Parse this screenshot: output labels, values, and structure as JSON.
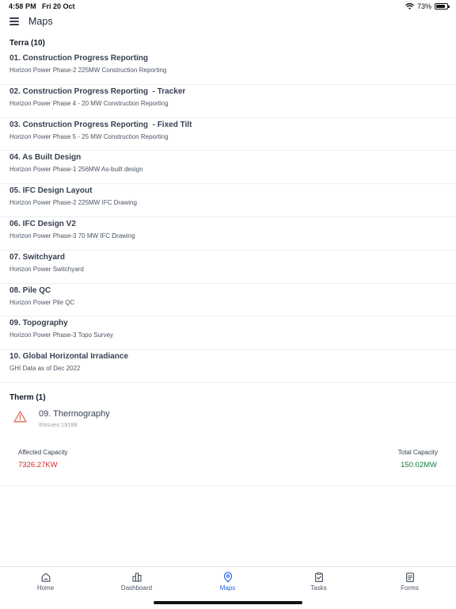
{
  "status_bar": {
    "time": "4:58 PM",
    "date": "Fri 20 Oct",
    "battery": "73%"
  },
  "header": {
    "title": "Maps"
  },
  "terra": {
    "heading": "Terra (10)",
    "items": [
      {
        "name": "01. Construction Progress Reporting",
        "description": "Horizon Power Phase-2 225MW Construction Reporting"
      },
      {
        "name": "02. Construction Progress Reporting  - Tracker",
        "description": "Horizon Power Phase 4 - 20 MW Construction Reporting"
      },
      {
        "name": "03. Construction Progress Reporting  - Fixed Tilt",
        "description": "Horizon Power Phase 5 - 25 MW Construction Reporting"
      },
      {
        "name": "04. As Built Design",
        "description": "Horizon Power Phase-1 256MW As-built design"
      },
      {
        "name": "05. IFC Design Layout",
        "description": "Horizon Power Phase-2 225MW IFC Drawing"
      },
      {
        "name": "06. IFC Design V2",
        "description": "Horizon Power Phase-3 70 MW IFC Drawing"
      },
      {
        "name": "07. Switchyard",
        "description": "Horizon Power Switchyard"
      },
      {
        "name": "08. Pile QC",
        "description": "Horizon Power Pile QC"
      },
      {
        "name": "09. Topography",
        "description": "Horizon Power Phase-3 Topo Survey"
      },
      {
        "name": "10. Global Horizontal Irradiance",
        "description": "GHI Data as of Dec 2022"
      }
    ]
  },
  "therm": {
    "heading": "Therm (1)",
    "item": {
      "icon": "warning-triangle-icon",
      "name": "09. Thermography",
      "issues": "#Issues:19188",
      "affected_capacity_label": "Affected Capacity",
      "affected_capacity_value": "7326.27KW",
      "total_capacity_label": "Total Capacity",
      "total_capacity_value": "150.02MW"
    }
  },
  "tabs": [
    {
      "label": "Home",
      "icon": "home-icon",
      "active": false
    },
    {
      "label": "Dashboard",
      "icon": "dashboard-icon",
      "active": false
    },
    {
      "label": "Maps",
      "icon": "map-pin-icon",
      "active": true
    },
    {
      "label": "Tasks",
      "icon": "tasks-icon",
      "active": false
    },
    {
      "label": "Forms",
      "icon": "forms-icon",
      "active": false
    }
  ],
  "colors": {
    "accent": "#2563eb",
    "danger": "#dc2626",
    "success": "#15803d"
  }
}
